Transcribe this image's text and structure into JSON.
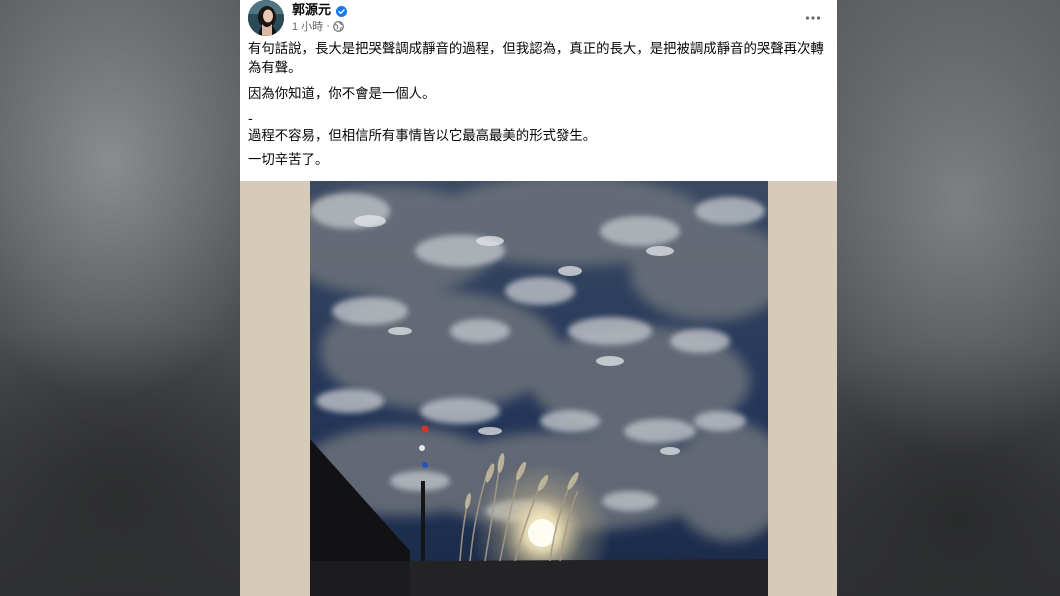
{
  "post": {
    "author": "郭源元",
    "time": "1 小時",
    "separator": "·",
    "paragraphs": [
      "有句話說，長大是把哭聲調成靜音的過程，但我認為，真正的長大，是把被調成靜音的哭聲再次轉為有聲。",
      "因為你知道，你不會是一個人。",
      "-",
      "過程不容易，但相信所有事情皆以它最高最美的形式發生。",
      "一切辛苦了。"
    ],
    "icons": {
      "verified": "verified-badge-icon",
      "privacy": "globe-icon",
      "more": "more-options-icon"
    },
    "photo_description_icon": "photo"
  },
  "colors": {
    "page_bg": "#4a4c4f",
    "card_bg": "#ffffff",
    "photo_matte": "#d6cbb9",
    "text": "#050505",
    "meta_text": "#65676b",
    "verified_blue": "#1877f2"
  }
}
